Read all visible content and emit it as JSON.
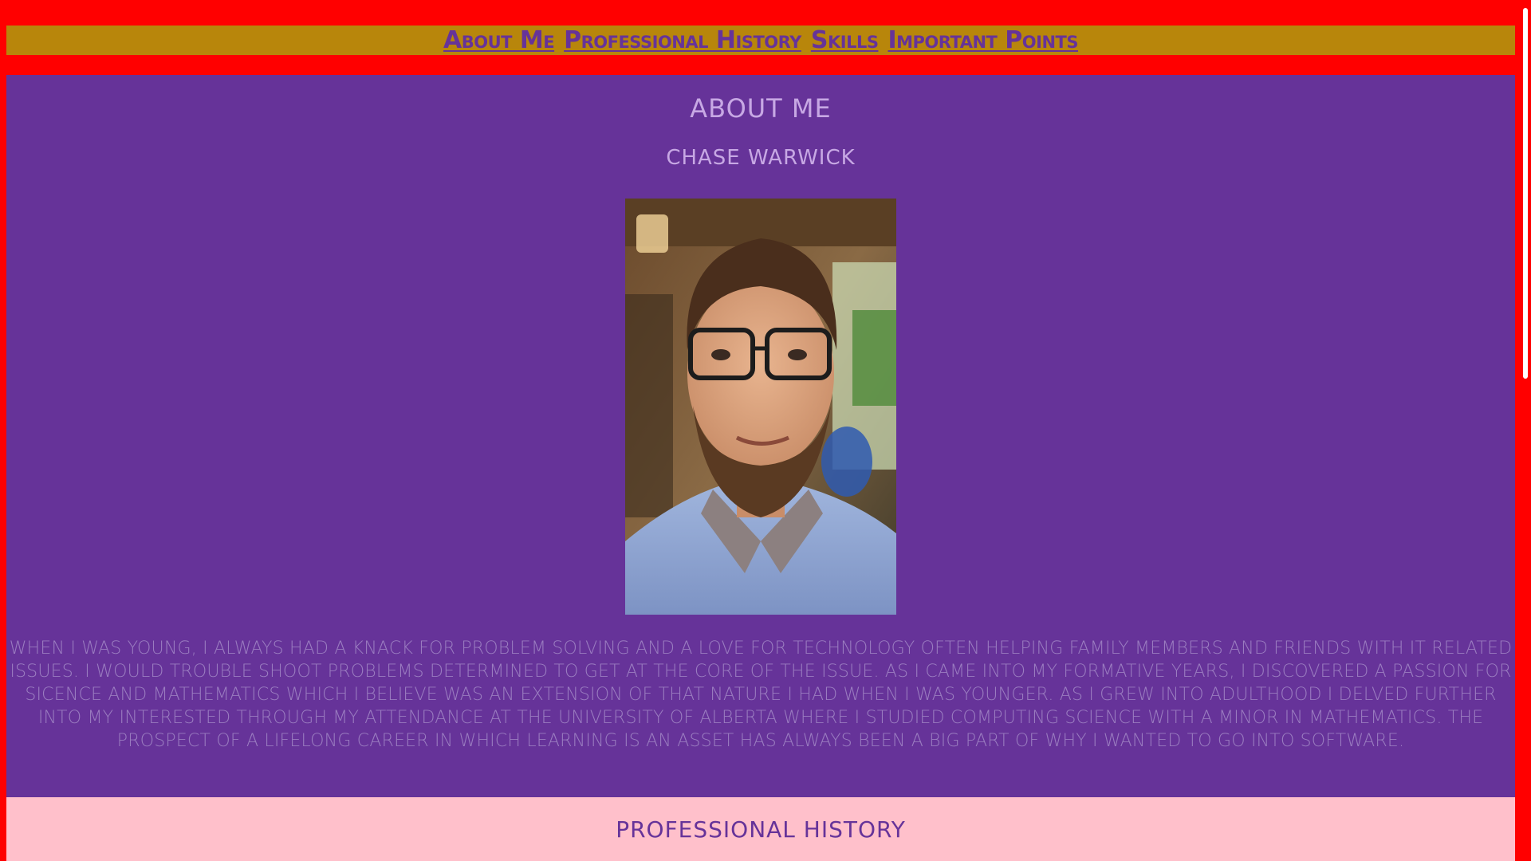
{
  "nav": {
    "items": [
      {
        "label": "About Me"
      },
      {
        "label": "Professional History"
      },
      {
        "label": "Skills"
      },
      {
        "label": "Important Points"
      }
    ]
  },
  "about": {
    "title": "About Me",
    "name": "Chase Warwick",
    "photo_alt": "portrait-photo",
    "bio": "When I was young, I always had a knack for problem solving and a love for technology often helping family members and friends with IT related issues. I would trouble shoot problems determined to get at the core of the issue. As I came into my formative years, I discovered a passion for sicence and mathematics which I believe was an extension of that nature I had when I was younger. As I grew into adulthood I delved further into my interested through my attendance at the University of Alberta where I studied Computing Science with a minor in Mathematics. The prospect of a lifelong career in which learning is an asset has always been a big part of why I wanted to go into software."
  },
  "history": {
    "title": "Professional History"
  },
  "colors": {
    "page_bg": "#ff0000",
    "nav_bg": "#b8860b",
    "about_bg": "#663399",
    "history_bg": "#ffc0cb",
    "link": "#663399"
  }
}
